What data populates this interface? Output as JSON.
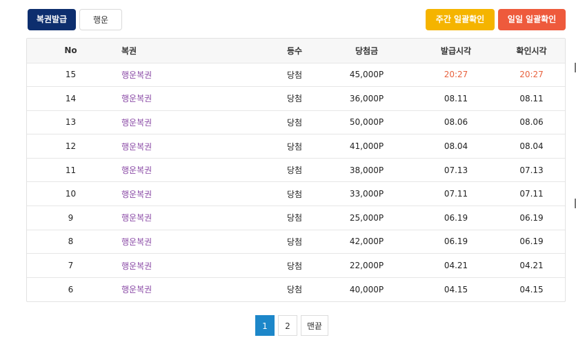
{
  "toolbar": {
    "issue_label": "복권발급",
    "luck_label": "행운",
    "weekly_label": "주간 일괄확인",
    "daily_label": "일일 일괄확인"
  },
  "table": {
    "headers": [
      "No",
      "복권",
      "등수",
      "당첨금",
      "발급시각",
      "확인시각"
    ],
    "rows": [
      {
        "no": "15",
        "name": "행운복권",
        "grade": "당첨",
        "prize": "45,000P",
        "issued": "20:27",
        "checked": "20:27",
        "highlight": true
      },
      {
        "no": "14",
        "name": "행운복권",
        "grade": "당첨",
        "prize": "36,000P",
        "issued": "08.11",
        "checked": "08.11"
      },
      {
        "no": "13",
        "name": "행운복권",
        "grade": "당첨",
        "prize": "50,000P",
        "issued": "08.06",
        "checked": "08.06"
      },
      {
        "no": "12",
        "name": "행운복권",
        "grade": "당첨",
        "prize": "41,000P",
        "issued": "08.04",
        "checked": "08.04"
      },
      {
        "no": "11",
        "name": "행운복권",
        "grade": "당첨",
        "prize": "38,000P",
        "issued": "07.13",
        "checked": "07.13"
      },
      {
        "no": "10",
        "name": "행운복권",
        "grade": "당첨",
        "prize": "33,000P",
        "issued": "07.11",
        "checked": "07.11"
      },
      {
        "no": "9",
        "name": "행운복권",
        "grade": "당첨",
        "prize": "25,000P",
        "issued": "06.19",
        "checked": "06.19"
      },
      {
        "no": "8",
        "name": "행운복권",
        "grade": "당첨",
        "prize": "42,000P",
        "issued": "06.19",
        "checked": "06.19"
      },
      {
        "no": "7",
        "name": "행운복권",
        "grade": "당첨",
        "prize": "22,000P",
        "issued": "04.21",
        "checked": "04.21"
      },
      {
        "no": "6",
        "name": "행운복권",
        "grade": "당첨",
        "prize": "40,000P",
        "issued": "04.15",
        "checked": "04.15"
      }
    ]
  },
  "pagination": {
    "pages": [
      "1",
      "2"
    ],
    "current": "1",
    "last_label": "맨끝"
  },
  "colors": {
    "issue_button": "#0d2e6e",
    "weekly_button": "#f5b400",
    "daily_button": "#ee5a3c",
    "ticket_link": "#8a4aa6",
    "highlight_time": "#e8613d",
    "active_page": "#1d87c9"
  }
}
